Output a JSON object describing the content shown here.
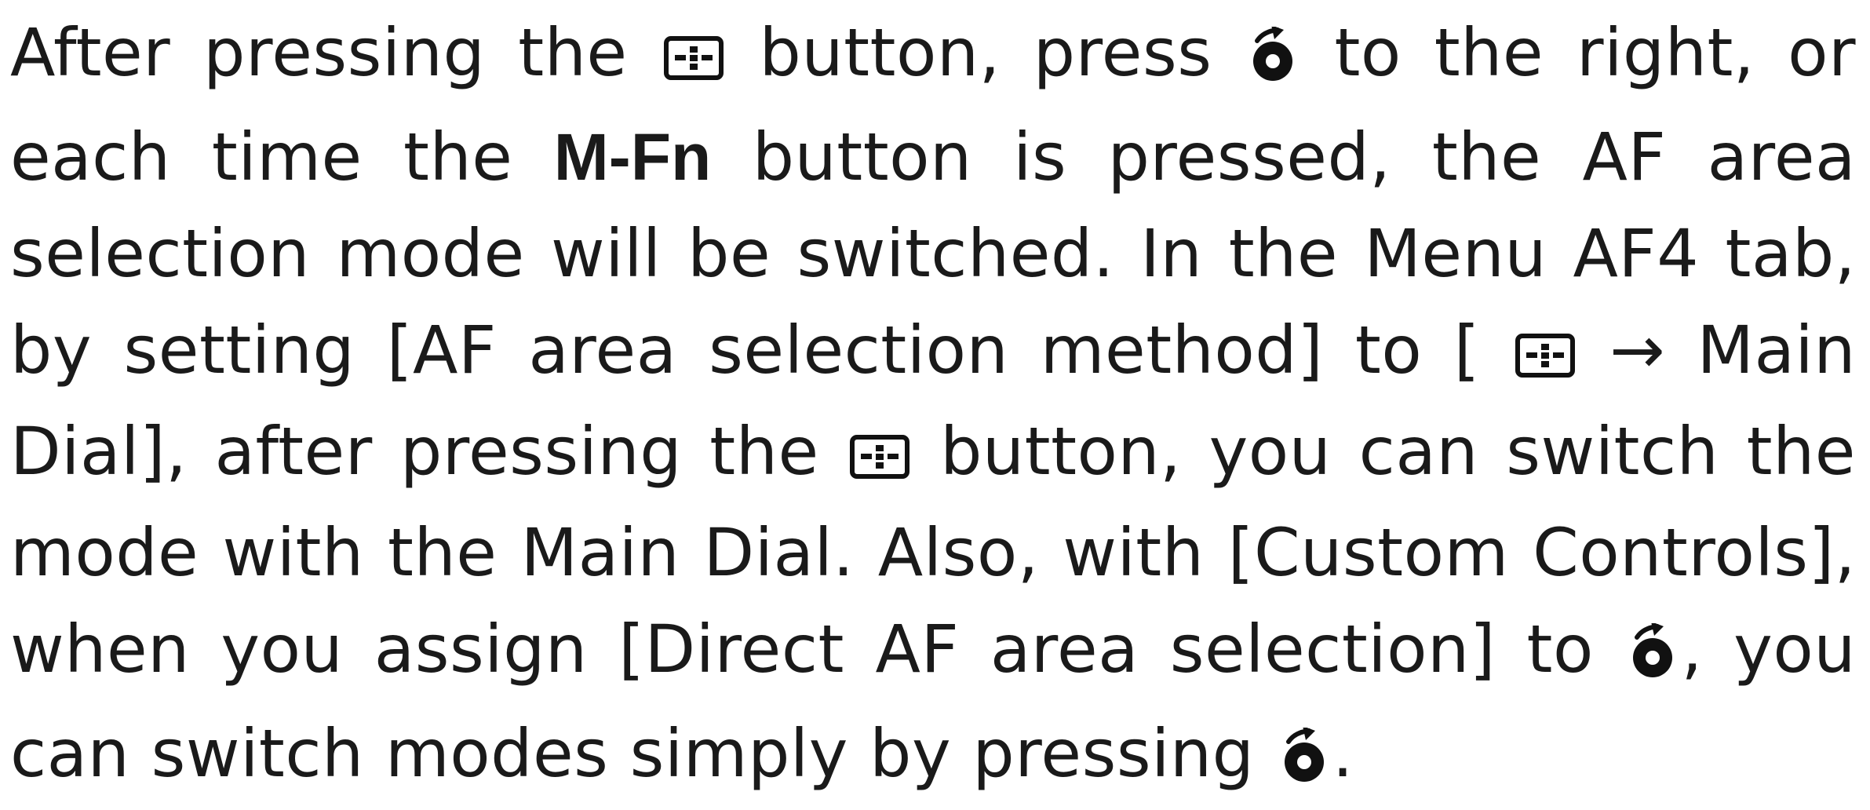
{
  "paragraph": {
    "s1": "After pressing the",
    "s2": "button, press",
    "s3": "to the right, or each time the",
    "m_fn": "M-Fn",
    "s4": "button is pressed, the AF area selection mode will be switched. In the Menu AF4 tab, by setting [AF area selection method] to [",
    "arrow": "→",
    "s5": "Main Dial], after pressing the",
    "s6": "button, you can switch the mode with the Main Dial. Also, with [Custom Controls], when you assign [Direct AF area selection] to",
    "s7": ", you can switch modes simply by pressing",
    "s8": "."
  },
  "icons": {
    "fn_button": "af-area-button-icon",
    "dial": "multi-selector-right-icon"
  },
  "colors": {
    "text": "#1a1a1a",
    "icon": "#111111",
    "background": "#ffffff"
  }
}
